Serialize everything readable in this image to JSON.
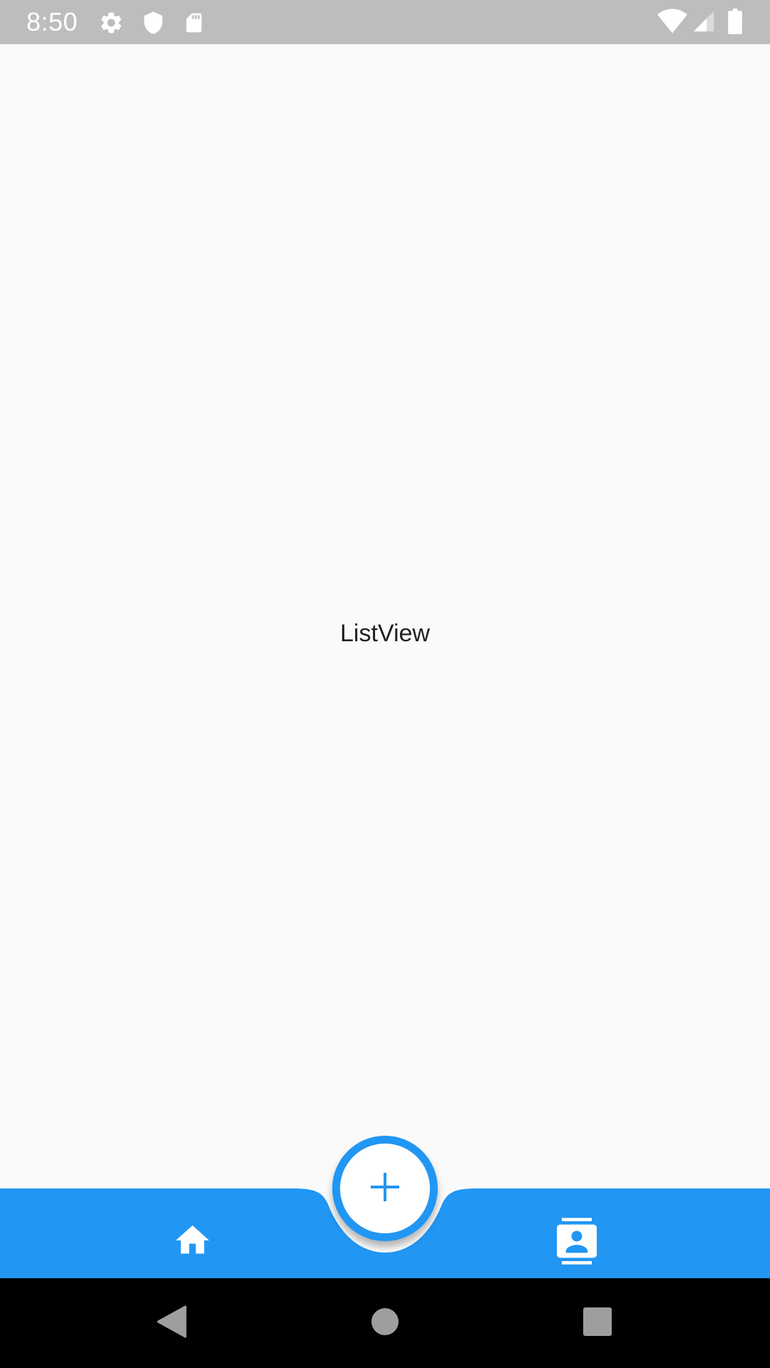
{
  "status_bar": {
    "time": "8:50",
    "left_icons": [
      "gear-icon",
      "shield-icon",
      "sd-card-icon"
    ],
    "right_icons": [
      "wifi-icon",
      "cell-signal-icon",
      "battery-icon"
    ],
    "background": "#bdbdbd"
  },
  "content": {
    "label": "ListView"
  },
  "bottom_bar": {
    "color": "#2196f3",
    "items": [
      {
        "icon": "home-icon"
      },
      {
        "icon": "contact-card-icon"
      }
    ],
    "fab_icon": "plus-icon",
    "fab_color": "#2196f3"
  },
  "system_nav": {
    "buttons": [
      "back-icon",
      "home-circle-icon",
      "recents-icon"
    ]
  }
}
